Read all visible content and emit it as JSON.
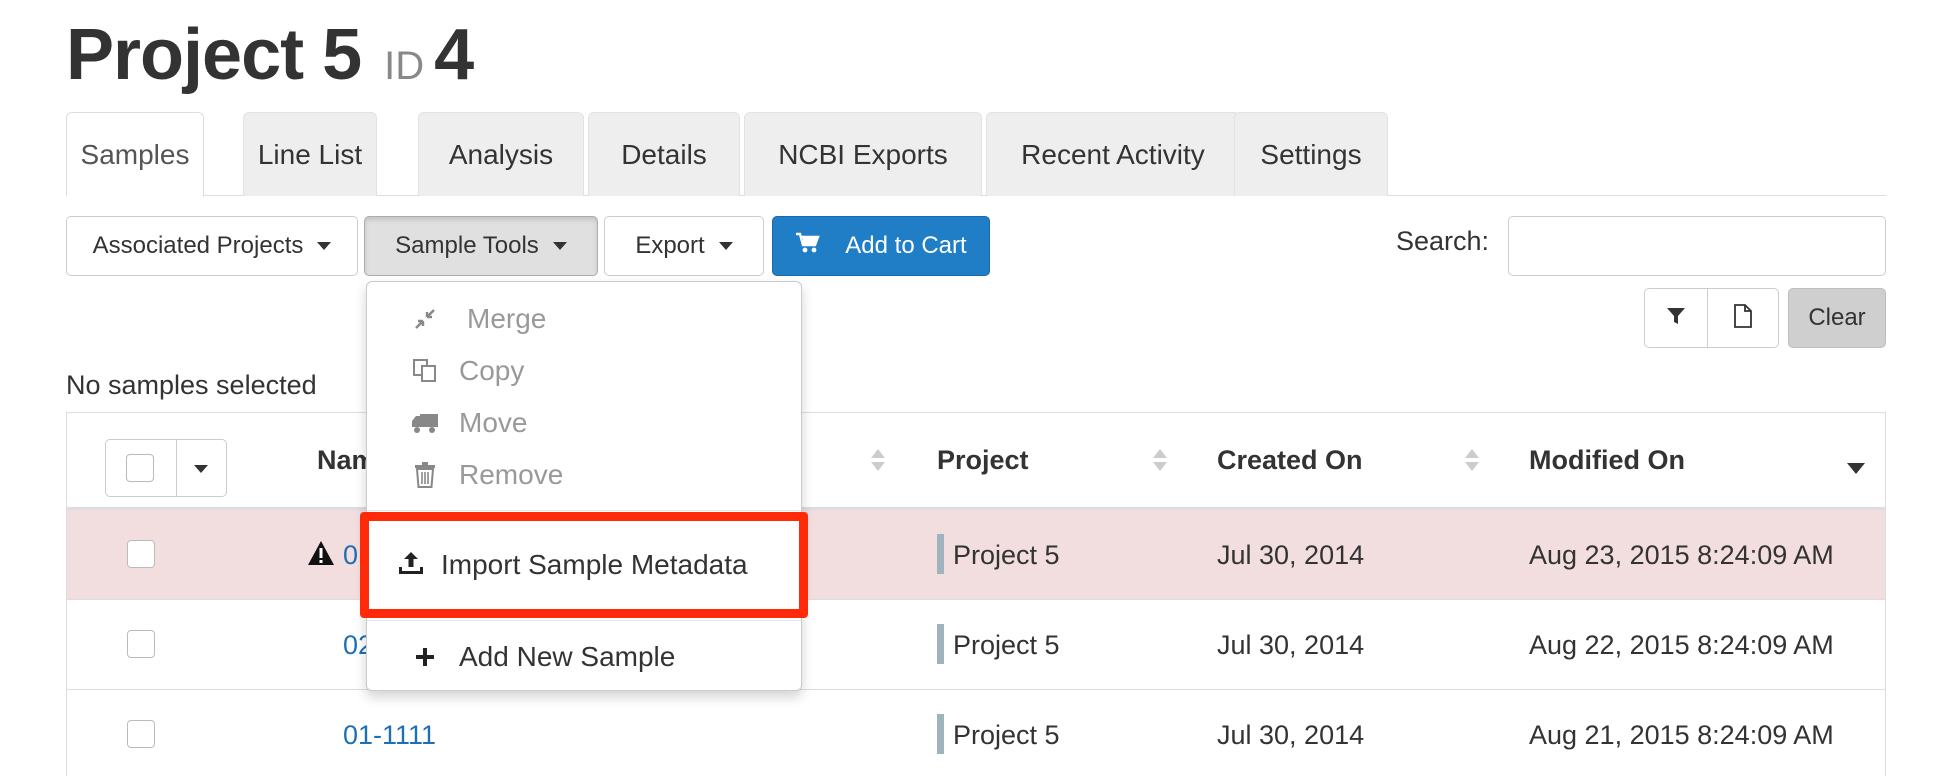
{
  "page": {
    "title": "Project 5",
    "id_label": "ID",
    "id_value": "4"
  },
  "tabs": [
    {
      "label": "Samples",
      "active": true
    },
    {
      "label": "Line List"
    },
    {
      "label": "Analysis"
    },
    {
      "label": "Details"
    },
    {
      "label": "NCBI Exports"
    },
    {
      "label": "Recent Activity"
    },
    {
      "label": "Settings"
    }
  ],
  "toolbar": {
    "associated_projects": "Associated Projects",
    "sample_tools": "Sample Tools",
    "export": "Export",
    "add_to_cart": "Add to Cart",
    "search_label": "Search:",
    "search_value": "",
    "clear": "Clear"
  },
  "selection_info": "No samples selected",
  "sample_tools_menu": {
    "items": [
      {
        "label": "Merge",
        "icon": "merge-icon",
        "disabled": true
      },
      {
        "label": "Copy",
        "icon": "copy-icon",
        "disabled": true
      },
      {
        "label": "Move",
        "icon": "truck-icon",
        "disabled": true
      },
      {
        "label": "Remove",
        "icon": "trash-icon",
        "disabled": true
      },
      {
        "label": "Import Sample Metadata",
        "icon": "upload-icon",
        "highlighted": true
      },
      {
        "label": "Add New Sample",
        "icon": "plus-icon"
      }
    ]
  },
  "table": {
    "columns": [
      "Name",
      "Project",
      "Created On",
      "Modified On"
    ],
    "rows": [
      {
        "name": "0",
        "project": "Project 5",
        "created": "Jul 30, 2014",
        "modified": "Aug 23, 2015 8:24:09 AM",
        "warning": true
      },
      {
        "name": "02",
        "project": "Project 5",
        "created": "Jul 30, 2014",
        "modified": "Aug 22, 2015 8:24:09 AM"
      },
      {
        "name": "01-1111",
        "project": "Project 5",
        "created": "Jul 30, 2014",
        "modified": "Aug 21, 2015 8:24:09 AM"
      }
    ]
  },
  "colors": {
    "primary": "#1f7ec6",
    "warning_row": "#f2dede",
    "highlight_border": "#ff2a0a",
    "link": "#1f6fb5"
  }
}
